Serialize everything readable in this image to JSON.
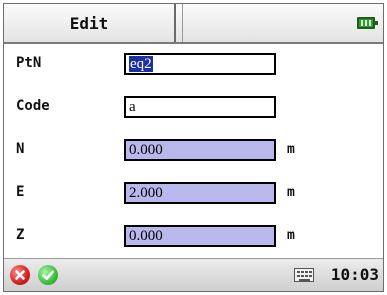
{
  "header": {
    "title": "Edit",
    "battery_icon": "battery-icon"
  },
  "form": {
    "ptn": {
      "label": "PtN",
      "value": "eq2"
    },
    "code": {
      "label": "Code",
      "value": "a"
    },
    "n": {
      "label": "N",
      "value": "0.000",
      "unit": "m"
    },
    "e": {
      "label": "E",
      "value": "2.000",
      "unit": "m"
    },
    "z": {
      "label": "Z",
      "value": "0.000",
      "unit": "m"
    }
  },
  "statusbar": {
    "cancel_icon": "close-circle-icon",
    "ok_icon": "check-circle-icon",
    "keyboard_icon": "keyboard-icon",
    "time": "10:03"
  },
  "colors": {
    "numeric_field_bg": "#b8b8ec",
    "selection_bg": "#1c2fa6",
    "cancel_red": "#d61f1f",
    "ok_green": "#3cbf3c",
    "battery_green": "#2f9e2f"
  }
}
